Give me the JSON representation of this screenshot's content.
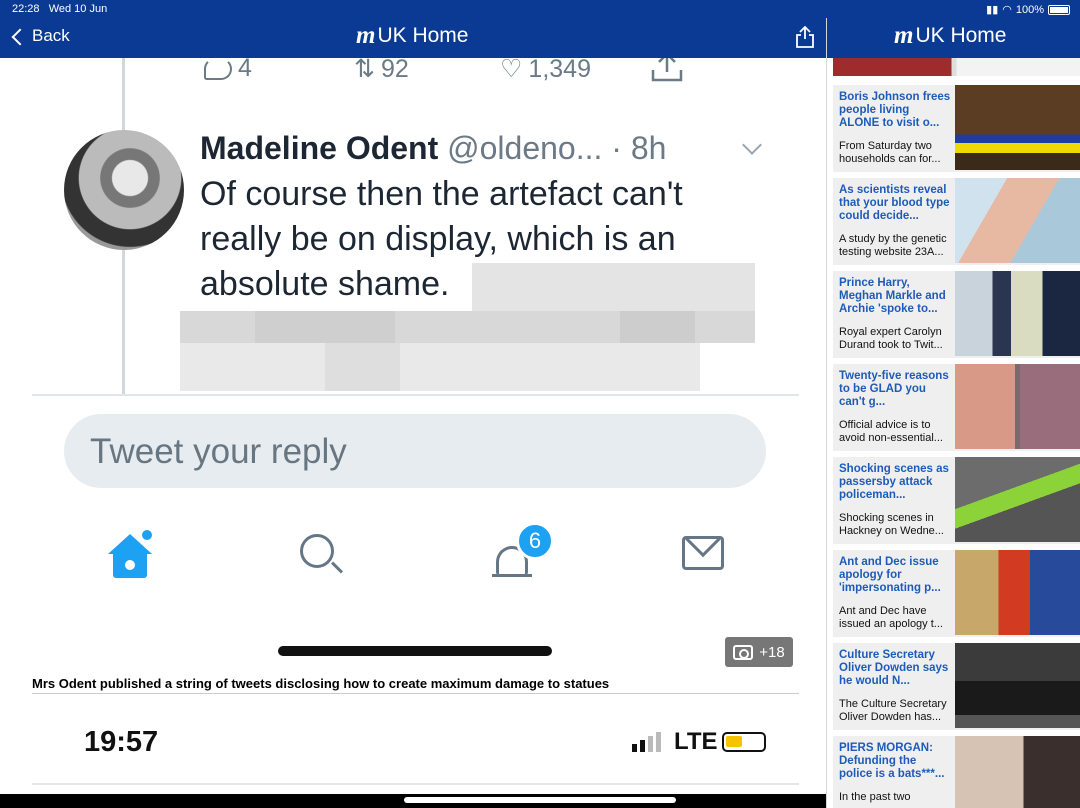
{
  "status_bar": {
    "time": "22:28",
    "date": "Wed 10 Jun",
    "battery": "100%"
  },
  "nav": {
    "back_label": "Back",
    "title": "UK Home",
    "side_title": "UK Home",
    "logo_glyph": "m"
  },
  "tweet": {
    "replies": "4",
    "retweets": "92",
    "likes": "1,349",
    "name": "Madeline Odent",
    "handle": "@oldeno...",
    "age": "· 8h",
    "text": "Of course then the artefact can't really be on display, which is an absolute shame.",
    "reply_placeholder": "Tweet your reply",
    "notifications": "6"
  },
  "photo_count": "+18",
  "caption": "Mrs Odent published a string of tweets disclosing how to create maximum damage to statues",
  "phone2": {
    "time": "19:57",
    "network": "LTE"
  },
  "sidebar": {
    "articles": [
      {
        "headline": "Boris Johnson frees people living ALONE to visit o...",
        "summary": "From Saturday two households can for...",
        "image": "press-briefing-image"
      },
      {
        "headline": "As scientists reveal that your blood type could decide...",
        "summary": "A study by the genetic testing website 23A...",
        "image": "blood-test-image"
      },
      {
        "headline": "Prince Harry, Meghan Markle and Archie 'spoke to...",
        "summary": "Royal expert Carolyn Durand took to Twit...",
        "image": "royal-family-image"
      },
      {
        "headline": "Twenty-five reasons to be GLAD you can't g...",
        "summary": "Official advice is to avoid non-essential...",
        "image": "sunburn-image"
      },
      {
        "headline": "Shocking scenes as passersby attack policeman...",
        "summary": "Shocking scenes in Hackney on Wedne...",
        "image": "street-bike-image"
      },
      {
        "headline": "Ant and Dec issue apology for 'impersonating p...",
        "summary": "Ant and Dec have issued an apology t...",
        "image": "tv-presenters-image"
      },
      {
        "headline": "Culture Secretary Oliver Dowden says he would N...",
        "summary": "The Culture Secretary Oliver Dowden has...",
        "image": "car-arrival-image"
      },
      {
        "headline": "PIERS MORGAN: Defunding the police is a bats***...",
        "summary": "In the past two",
        "image": "piers-morgan-image"
      }
    ]
  },
  "colors": {
    "header_blue": "#0b3a94",
    "link_blue": "#1e5bb8",
    "twitter_blue": "#1da1f2"
  }
}
